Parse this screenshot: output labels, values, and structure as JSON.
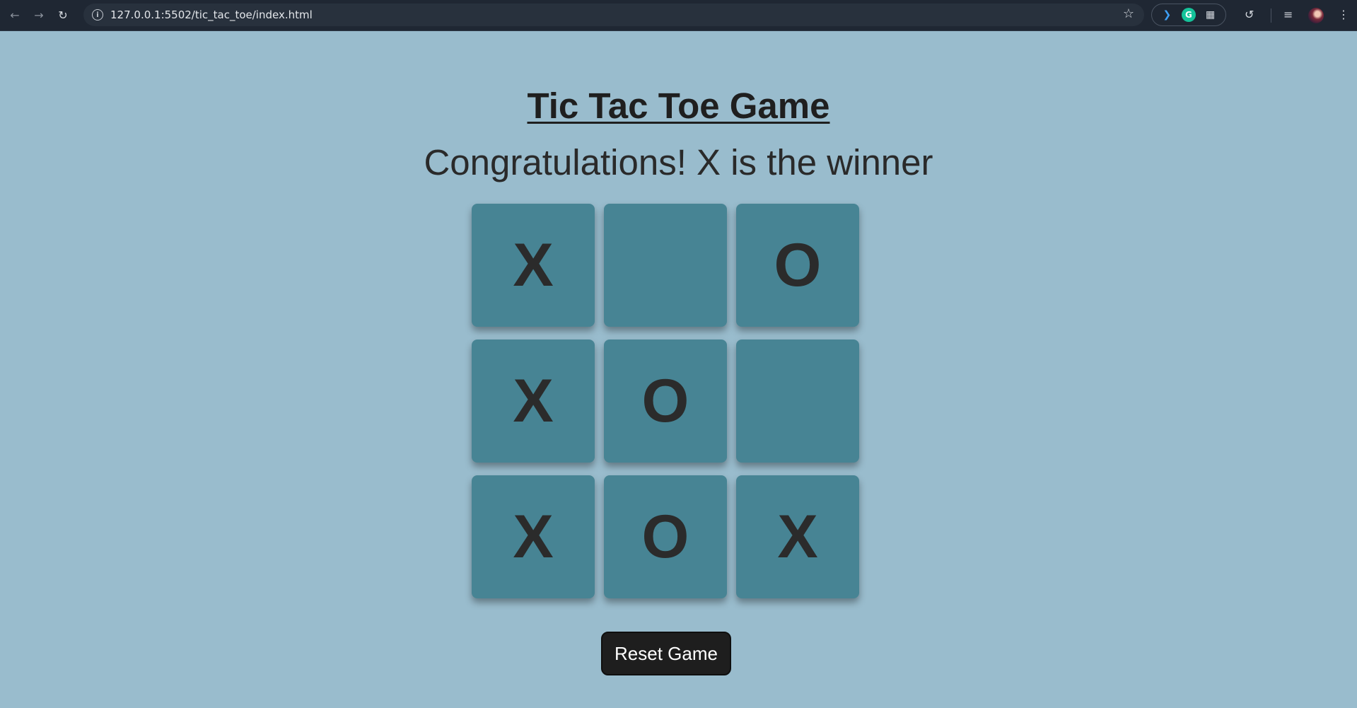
{
  "browser": {
    "url": "127.0.0.1:5502/tic_tac_toe/index.html"
  },
  "page": {
    "title": "Tic Tac Toe Game",
    "status": "Congratulations! X is the winner",
    "reset_label": "Reset Game"
  },
  "board": {
    "cells": [
      "X",
      "",
      "O",
      "X",
      "O",
      "",
      "X",
      "O",
      "X"
    ]
  },
  "colors": {
    "background": "#99bccd",
    "cell": "#478494",
    "button": "#1e1e1e"
  }
}
